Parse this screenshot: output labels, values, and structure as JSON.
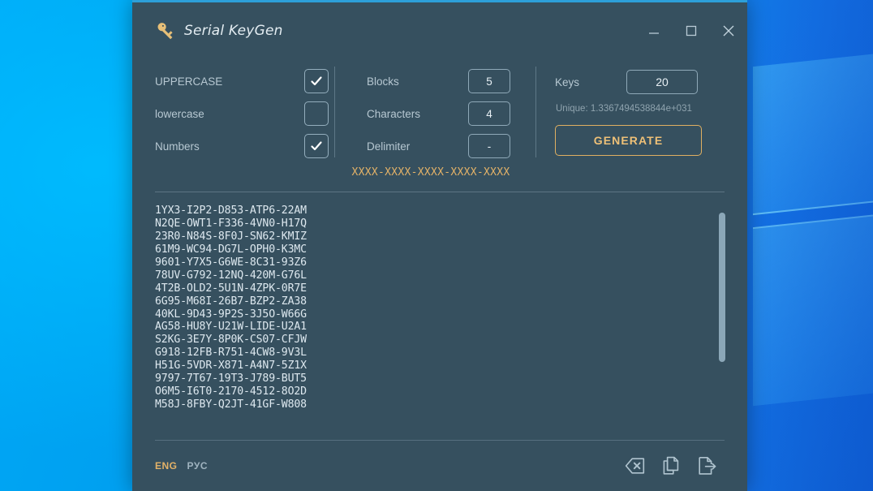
{
  "desktop": {
    "wallpaper_name": "windows-10-blue-wallpaper"
  },
  "window": {
    "title": "Serial KeyGen",
    "icon": "key-icon",
    "controls": {
      "minimize": "minimize-icon",
      "maximize": "maximize-icon",
      "close": "close-icon"
    }
  },
  "charset_options": [
    {
      "label": "UPPERCASE",
      "checked": true
    },
    {
      "label": "lowercase",
      "checked": false
    },
    {
      "label": "Numbers",
      "checked": true
    }
  ],
  "format_options": [
    {
      "label": "Blocks",
      "value": "5"
    },
    {
      "label": "Characters",
      "value": "4"
    },
    {
      "label": "Delimiter",
      "value": "-"
    }
  ],
  "keys_panel": {
    "label": "Keys",
    "value": "20",
    "unique_text": "Unique: 1.3367494538844e+031",
    "generate_label": "GENERATE"
  },
  "pattern": "XXXX-XXXX-XXXX-XXXX-XXXX",
  "keys": [
    "1YX3-I2P2-D853-ATP6-22AM",
    "N2QE-OWT1-F336-4VN0-H17Q",
    "23R0-N84S-8F0J-SN62-KMIZ",
    "61M9-WC94-DG7L-OPH0-K3MC",
    "9601-Y7X5-G6WE-8C31-93Z6",
    "78UV-G792-12NQ-420M-G76L",
    "4T2B-OLD2-5U1N-4ZPK-0R7E",
    "6G95-M68I-26B7-BZP2-ZA38",
    "40KL-9D43-9P2S-3J5O-W66G",
    "AG58-HU8Y-U21W-LIDE-U2A1",
    "S2KG-3E7Y-8P0K-CS07-CFJW",
    "G918-12FB-R751-4CW8-9V3L",
    "H51G-5VDR-X871-A4N7-5Z1X",
    "9797-7T67-19T3-J789-BUT5",
    "O6M5-I6T0-2170-4512-8O2D",
    "M58J-8FBY-Q2JT-41GF-W808"
  ],
  "footer": {
    "lang_active": "ENG",
    "lang_other": "РУС",
    "actions": [
      {
        "name": "clear-icon"
      },
      {
        "name": "copy-icon"
      },
      {
        "name": "export-icon"
      }
    ]
  },
  "colors": {
    "window_bg": "#36505f",
    "accent_amber": "#e3b268",
    "text_primary": "#dde8ef",
    "text_muted": "#8fa3ae",
    "desktop_blue": "#00a2f3",
    "title_accent_line": "#2d9fd9"
  }
}
